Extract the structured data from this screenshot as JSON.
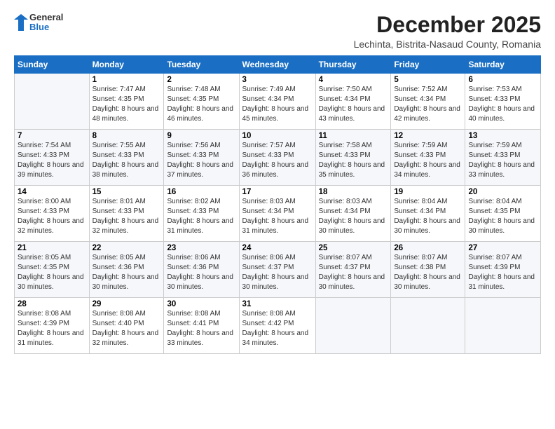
{
  "logo": {
    "general": "General",
    "blue": "Blue"
  },
  "header": {
    "month_year": "December 2025",
    "location": "Lechinta, Bistrita-Nasaud County, Romania"
  },
  "weekdays": [
    "Sunday",
    "Monday",
    "Tuesday",
    "Wednesday",
    "Thursday",
    "Friday",
    "Saturday"
  ],
  "weeks": [
    [
      {
        "day": "",
        "sunrise": "",
        "sunset": "",
        "daylight": ""
      },
      {
        "day": "1",
        "sunrise": "Sunrise: 7:47 AM",
        "sunset": "Sunset: 4:35 PM",
        "daylight": "Daylight: 8 hours and 48 minutes."
      },
      {
        "day": "2",
        "sunrise": "Sunrise: 7:48 AM",
        "sunset": "Sunset: 4:35 PM",
        "daylight": "Daylight: 8 hours and 46 minutes."
      },
      {
        "day": "3",
        "sunrise": "Sunrise: 7:49 AM",
        "sunset": "Sunset: 4:34 PM",
        "daylight": "Daylight: 8 hours and 45 minutes."
      },
      {
        "day": "4",
        "sunrise": "Sunrise: 7:50 AM",
        "sunset": "Sunset: 4:34 PM",
        "daylight": "Daylight: 8 hours and 43 minutes."
      },
      {
        "day": "5",
        "sunrise": "Sunrise: 7:52 AM",
        "sunset": "Sunset: 4:34 PM",
        "daylight": "Daylight: 8 hours and 42 minutes."
      },
      {
        "day": "6",
        "sunrise": "Sunrise: 7:53 AM",
        "sunset": "Sunset: 4:33 PM",
        "daylight": "Daylight: 8 hours and 40 minutes."
      }
    ],
    [
      {
        "day": "7",
        "sunrise": "Sunrise: 7:54 AM",
        "sunset": "Sunset: 4:33 PM",
        "daylight": "Daylight: 8 hours and 39 minutes."
      },
      {
        "day": "8",
        "sunrise": "Sunrise: 7:55 AM",
        "sunset": "Sunset: 4:33 PM",
        "daylight": "Daylight: 8 hours and 38 minutes."
      },
      {
        "day": "9",
        "sunrise": "Sunrise: 7:56 AM",
        "sunset": "Sunset: 4:33 PM",
        "daylight": "Daylight: 8 hours and 37 minutes."
      },
      {
        "day": "10",
        "sunrise": "Sunrise: 7:57 AM",
        "sunset": "Sunset: 4:33 PM",
        "daylight": "Daylight: 8 hours and 36 minutes."
      },
      {
        "day": "11",
        "sunrise": "Sunrise: 7:58 AM",
        "sunset": "Sunset: 4:33 PM",
        "daylight": "Daylight: 8 hours and 35 minutes."
      },
      {
        "day": "12",
        "sunrise": "Sunrise: 7:59 AM",
        "sunset": "Sunset: 4:33 PM",
        "daylight": "Daylight: 8 hours and 34 minutes."
      },
      {
        "day": "13",
        "sunrise": "Sunrise: 7:59 AM",
        "sunset": "Sunset: 4:33 PM",
        "daylight": "Daylight: 8 hours and 33 minutes."
      }
    ],
    [
      {
        "day": "14",
        "sunrise": "Sunrise: 8:00 AM",
        "sunset": "Sunset: 4:33 PM",
        "daylight": "Daylight: 8 hours and 32 minutes."
      },
      {
        "day": "15",
        "sunrise": "Sunrise: 8:01 AM",
        "sunset": "Sunset: 4:33 PM",
        "daylight": "Daylight: 8 hours and 32 minutes."
      },
      {
        "day": "16",
        "sunrise": "Sunrise: 8:02 AM",
        "sunset": "Sunset: 4:33 PM",
        "daylight": "Daylight: 8 hours and 31 minutes."
      },
      {
        "day": "17",
        "sunrise": "Sunrise: 8:03 AM",
        "sunset": "Sunset: 4:34 PM",
        "daylight": "Daylight: 8 hours and 31 minutes."
      },
      {
        "day": "18",
        "sunrise": "Sunrise: 8:03 AM",
        "sunset": "Sunset: 4:34 PM",
        "daylight": "Daylight: 8 hours and 30 minutes."
      },
      {
        "day": "19",
        "sunrise": "Sunrise: 8:04 AM",
        "sunset": "Sunset: 4:34 PM",
        "daylight": "Daylight: 8 hours and 30 minutes."
      },
      {
        "day": "20",
        "sunrise": "Sunrise: 8:04 AM",
        "sunset": "Sunset: 4:35 PM",
        "daylight": "Daylight: 8 hours and 30 minutes."
      }
    ],
    [
      {
        "day": "21",
        "sunrise": "Sunrise: 8:05 AM",
        "sunset": "Sunset: 4:35 PM",
        "daylight": "Daylight: 8 hours and 30 minutes."
      },
      {
        "day": "22",
        "sunrise": "Sunrise: 8:05 AM",
        "sunset": "Sunset: 4:36 PM",
        "daylight": "Daylight: 8 hours and 30 minutes."
      },
      {
        "day": "23",
        "sunrise": "Sunrise: 8:06 AM",
        "sunset": "Sunset: 4:36 PM",
        "daylight": "Daylight: 8 hours and 30 minutes."
      },
      {
        "day": "24",
        "sunrise": "Sunrise: 8:06 AM",
        "sunset": "Sunset: 4:37 PM",
        "daylight": "Daylight: 8 hours and 30 minutes."
      },
      {
        "day": "25",
        "sunrise": "Sunrise: 8:07 AM",
        "sunset": "Sunset: 4:37 PM",
        "daylight": "Daylight: 8 hours and 30 minutes."
      },
      {
        "day": "26",
        "sunrise": "Sunrise: 8:07 AM",
        "sunset": "Sunset: 4:38 PM",
        "daylight": "Daylight: 8 hours and 30 minutes."
      },
      {
        "day": "27",
        "sunrise": "Sunrise: 8:07 AM",
        "sunset": "Sunset: 4:39 PM",
        "daylight": "Daylight: 8 hours and 31 minutes."
      }
    ],
    [
      {
        "day": "28",
        "sunrise": "Sunrise: 8:08 AM",
        "sunset": "Sunset: 4:39 PM",
        "daylight": "Daylight: 8 hours and 31 minutes."
      },
      {
        "day": "29",
        "sunrise": "Sunrise: 8:08 AM",
        "sunset": "Sunset: 4:40 PM",
        "daylight": "Daylight: 8 hours and 32 minutes."
      },
      {
        "day": "30",
        "sunrise": "Sunrise: 8:08 AM",
        "sunset": "Sunset: 4:41 PM",
        "daylight": "Daylight: 8 hours and 33 minutes."
      },
      {
        "day": "31",
        "sunrise": "Sunrise: 8:08 AM",
        "sunset": "Sunset: 4:42 PM",
        "daylight": "Daylight: 8 hours and 34 minutes."
      },
      {
        "day": "",
        "sunrise": "",
        "sunset": "",
        "daylight": ""
      },
      {
        "day": "",
        "sunrise": "",
        "sunset": "",
        "daylight": ""
      },
      {
        "day": "",
        "sunrise": "",
        "sunset": "",
        "daylight": ""
      }
    ]
  ]
}
